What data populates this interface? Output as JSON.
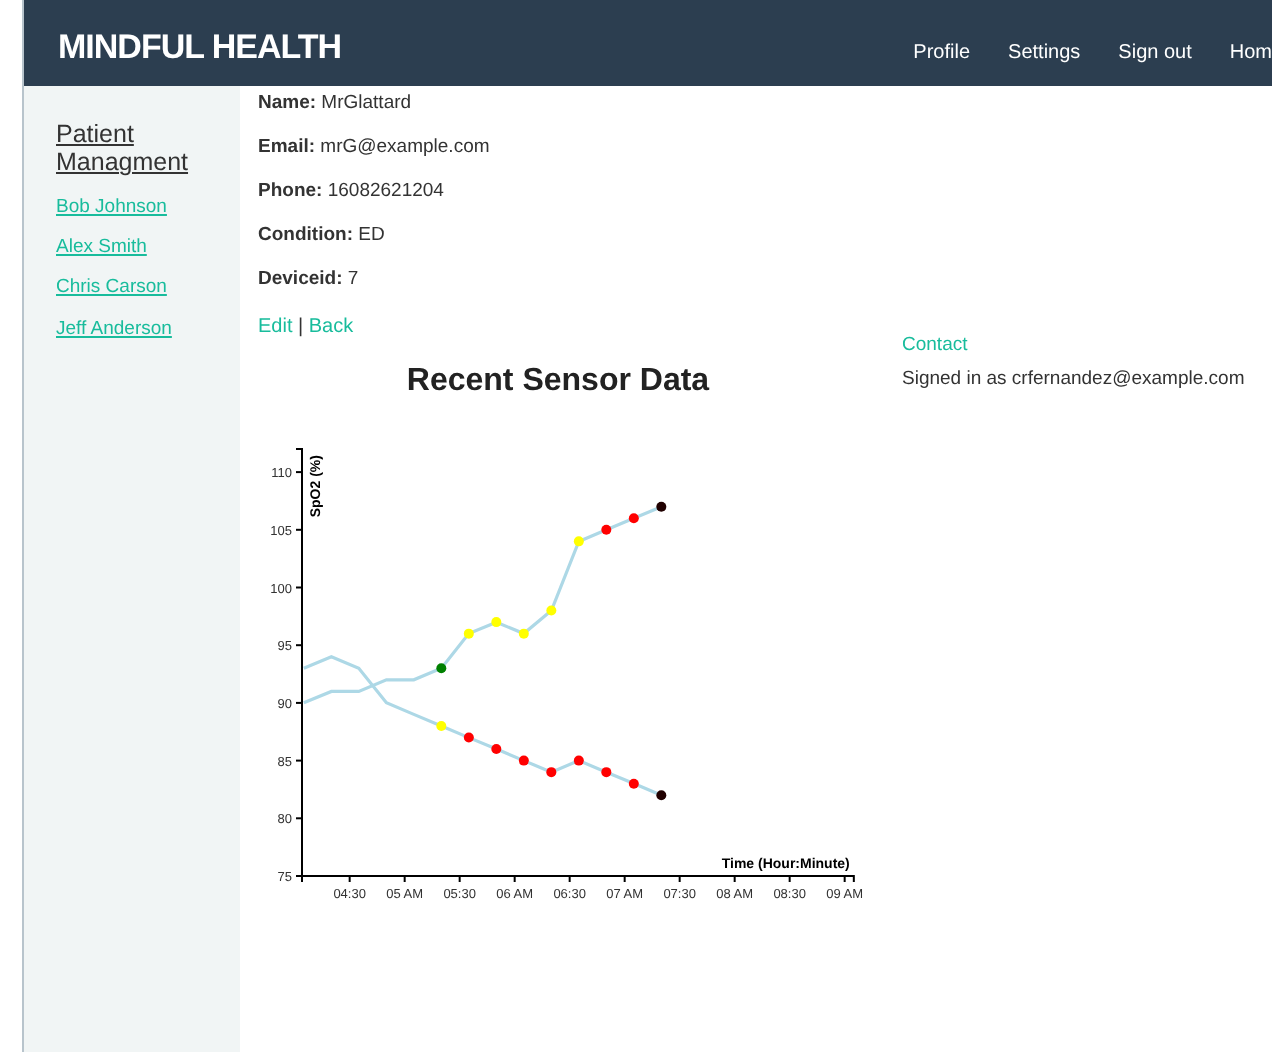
{
  "brand": "MINDFUL HEALTH",
  "nav": [
    "Profile",
    "Settings",
    "Sign out",
    "Hom"
  ],
  "sidebar": {
    "title": "Patient Managment",
    "items": [
      "Bob Johnson",
      "Alex Smith",
      "Chris Carson",
      "Jeff Anderson"
    ]
  },
  "details": [
    {
      "label": "Name:",
      "value": "MrGlattard"
    },
    {
      "label": "Email:",
      "value": "mrG@example.com"
    },
    {
      "label": "Phone:",
      "value": "16082621204"
    },
    {
      "label": "Condition:",
      "value": "ED"
    },
    {
      "label": "Deviceid:",
      "value": "7"
    }
  ],
  "actions": {
    "edit": "Edit",
    "separator": "|",
    "back": "Back"
  },
  "side_info": {
    "link": "Contact",
    "text": "Signed in as crfernandez@example.com"
  },
  "chart_data": {
    "type": "line",
    "title": "Recent Sensor Data",
    "xlabel": "Time (Hour:Minute)",
    "ylabel": "SpO2 (%)",
    "x": [
      4.0833,
      4.3333,
      4.5833,
      4.8333,
      5.0833,
      5.3333,
      5.5833,
      5.8333,
      6.0833,
      6.3333,
      6.5833,
      6.8333,
      7.0833,
      7.3333
    ],
    "series": [
      {
        "color": "#add8e6",
        "values": [
          90,
          91,
          91,
          92,
          92,
          93,
          96,
          97,
          96,
          98,
          104,
          105,
          106,
          107
        ]
      },
      {
        "color": "#add8e6",
        "values": [
          93,
          94,
          93,
          90,
          89,
          88,
          87,
          86,
          85,
          84,
          85,
          84,
          83,
          82
        ]
      },
      {
        "type": "scatter",
        "color": "#008000",
        "values": [
          null,
          null,
          null,
          null,
          null,
          93,
          null,
          null,
          null,
          null,
          null,
          null,
          null,
          null
        ]
      },
      {
        "type": "scatter",
        "color": "#ffff00",
        "values": [
          null,
          null,
          null,
          null,
          null,
          null,
          96,
          97,
          96,
          98,
          104,
          null,
          null,
          null
        ]
      },
      {
        "type": "scatter",
        "color": "#ff0000",
        "values": [
          null,
          null,
          null,
          null,
          null,
          null,
          null,
          null,
          null,
          null,
          null,
          105,
          106,
          null
        ]
      },
      {
        "type": "scatter",
        "color": "#200000",
        "values": [
          null,
          null,
          null,
          null,
          null,
          null,
          null,
          null,
          null,
          null,
          null,
          null,
          null,
          107
        ]
      },
      {
        "type": "scatter",
        "color": "#ffff00",
        "values": [
          null,
          null,
          null,
          null,
          null,
          88,
          null,
          null,
          null,
          null,
          null,
          null,
          null,
          null
        ]
      },
      {
        "type": "scatter",
        "color": "#ff0000",
        "values": [
          null,
          null,
          null,
          null,
          null,
          null,
          87,
          86,
          85,
          84,
          85,
          84,
          83,
          null
        ]
      },
      {
        "type": "scatter",
        "color": "#200000",
        "values": [
          null,
          null,
          null,
          null,
          null,
          null,
          null,
          null,
          null,
          null,
          null,
          null,
          null,
          82
        ]
      }
    ],
    "xlim": [
      4.0667,
      9.0833
    ],
    "ylim": [
      75,
      112
    ],
    "xticks": [
      {
        "value": 4.5,
        "label": "04:30"
      },
      {
        "value": 5,
        "label": "05 AM"
      },
      {
        "value": 5.5,
        "label": "05:30"
      },
      {
        "value": 6,
        "label": "06 AM"
      },
      {
        "value": 6.5,
        "label": "06:30"
      },
      {
        "value": 7,
        "label": "07 AM"
      },
      {
        "value": 7.5,
        "label": "07:30"
      },
      {
        "value": 8,
        "label": "08 AM"
      },
      {
        "value": 8.5,
        "label": "08:30"
      },
      {
        "value": 9,
        "label": "09 AM"
      }
    ],
    "yticks": [
      75,
      80,
      85,
      90,
      95,
      100,
      105,
      110
    ]
  }
}
